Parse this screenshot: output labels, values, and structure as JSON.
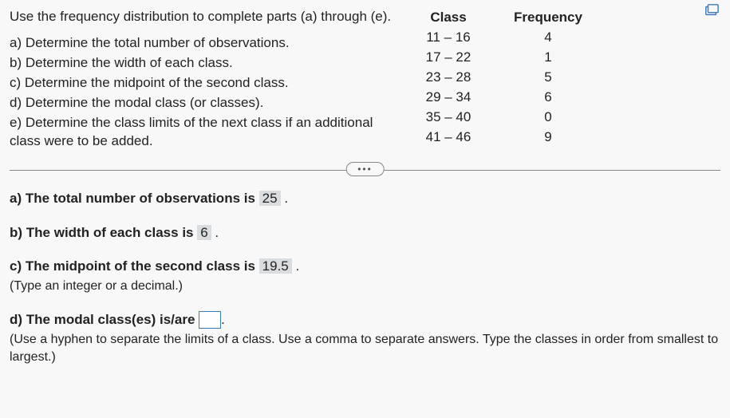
{
  "intro": "Use the frequency distribution to complete parts (a) through (e).",
  "parts": {
    "a": "a) Determine the total number of observations.",
    "b": "b) Determine the width of each class.",
    "c": "c) Determine the midpoint of the second class.",
    "d": "d) Determine the modal class (or classes).",
    "e": "e) Determine the class limits of the next class if an additional class were to be added."
  },
  "table": {
    "header_class": "Class",
    "header_freq": "Frequency",
    "rows": [
      {
        "class": "11 – 16",
        "freq": "4"
      },
      {
        "class": "17 – 22",
        "freq": "1"
      },
      {
        "class": "23 – 28",
        "freq": "5"
      },
      {
        "class": "29 – 34",
        "freq": "6"
      },
      {
        "class": "35 – 40",
        "freq": "0"
      },
      {
        "class": "41 – 46",
        "freq": "9"
      }
    ]
  },
  "answers": {
    "a_pre": "a) The total number of observations is ",
    "a_val": "25",
    "a_post": " .",
    "b_pre": "b) The width of each class is ",
    "b_val": "6",
    "b_post": " .",
    "c_pre": "c) The midpoint of the second class is ",
    "c_val": "19.5",
    "c_post": " .",
    "c_hint": "(Type an integer or a decimal.)",
    "d_pre": "d) The modal class(es) is/are ",
    "d_post": ".",
    "d_hint": "(Use a hyphen to separate the limits of a class. Use a comma to separate answers. Type the classes in order from smallest to largest.)"
  },
  "ellipsis": "•••",
  "chart_data": {
    "type": "table",
    "columns": [
      "Class",
      "Frequency"
    ],
    "rows": [
      [
        "11 – 16",
        4
      ],
      [
        "17 – 22",
        1
      ],
      [
        "23 – 28",
        5
      ],
      [
        "29 – 34",
        6
      ],
      [
        "35 – 40",
        0
      ],
      [
        "41 – 46",
        9
      ]
    ]
  }
}
